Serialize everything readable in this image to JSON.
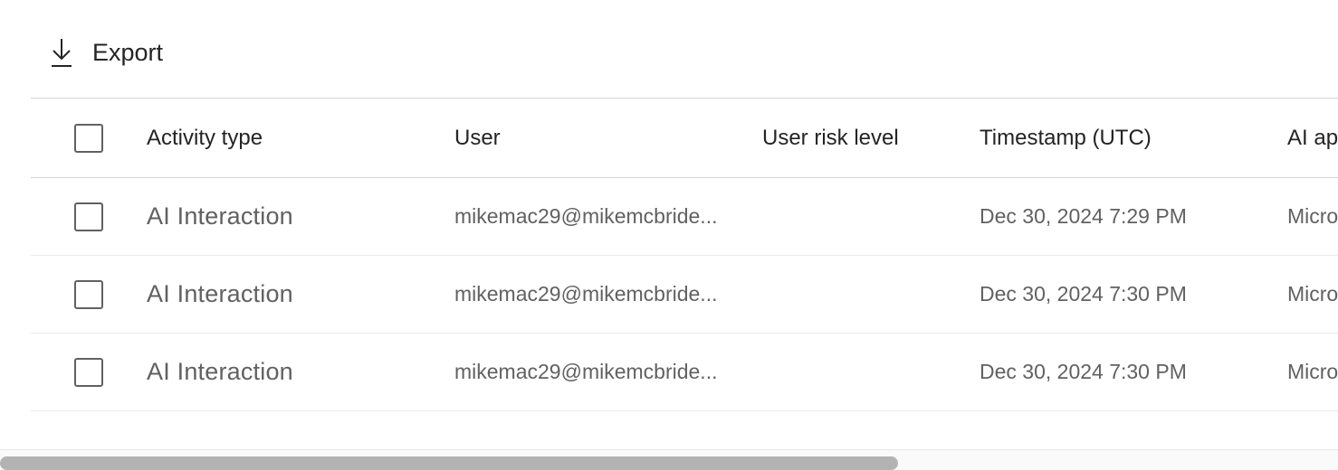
{
  "toolbar": {
    "export_label": "Export",
    "export_icon": "download-arrow-icon"
  },
  "table": {
    "columns": [
      "Activity type",
      "User",
      "User risk level",
      "Timestamp (UTC)",
      "AI ap"
    ],
    "rows": [
      {
        "activity_type": "AI Interaction",
        "user": "mikemac29@mikemcbride...",
        "user_risk_level": "",
        "timestamp": "Dec 30, 2024 7:29 PM",
        "ai_app": "Micro"
      },
      {
        "activity_type": "AI Interaction",
        "user": "mikemac29@mikemcbride...",
        "user_risk_level": "",
        "timestamp": "Dec 30, 2024 7:30 PM",
        "ai_app": "Micro"
      },
      {
        "activity_type": "AI Interaction",
        "user": "mikemac29@mikemcbride...",
        "user_risk_level": "",
        "timestamp": "Dec 30, 2024 7:30 PM",
        "ai_app": "Micro"
      }
    ]
  },
  "colors": {
    "text_primary": "#242424",
    "text_secondary": "#616161",
    "scroll_thumb": "#b3b3b3"
  }
}
